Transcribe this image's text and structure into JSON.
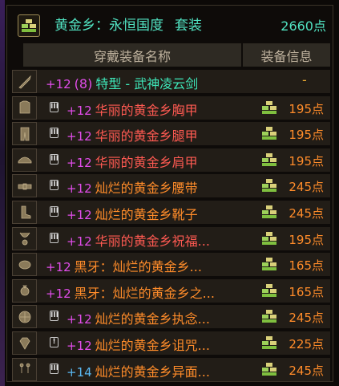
{
  "set": {
    "icon": "set-icon",
    "title": "黄金乡：永恒国度",
    "suffix": "套装",
    "points": "2660点"
  },
  "columns": {
    "name": "穿戴装备名称",
    "info": "装备信息"
  },
  "weapon": {
    "icon": "sword-icon",
    "plus": "+12",
    "refine": "(8)",
    "name": "特型 - 武神凌云剑",
    "info": "-"
  },
  "items": [
    {
      "icon": "armor-chest-icon",
      "plus": "+12",
      "name": "华丽的黄金乡胸甲",
      "points": "195点"
    },
    {
      "icon": "armor-legs-icon",
      "plus": "+12",
      "name": "华丽的黄金乡腿甲",
      "points": "195点"
    },
    {
      "icon": "armor-shoulder-icon",
      "plus": "+12",
      "name": "华丽的黄金乡肩甲",
      "points": "195点"
    },
    {
      "icon": "armor-belt-icon",
      "plus": "+12",
      "name": "灿烂的黄金乡腰带",
      "points": "245点"
    },
    {
      "icon": "armor-boots-icon",
      "plus": "+12",
      "name": "灿烂的黄金乡靴子",
      "points": "245点"
    },
    {
      "icon": "necklace-icon",
      "plus": "+12",
      "name": "华丽的黄金乡祝福...",
      "points": "195点"
    },
    {
      "icon": "bracelet-icon",
      "plus": "+12",
      "prefix": "黑牙：",
      "name": "灿烂的黄金乡...",
      "points": "165点"
    },
    {
      "icon": "ring-icon",
      "plus": "+12",
      "prefix": "黑牙：",
      "name": "灿烂的黄金乡之...",
      "points": "165点"
    },
    {
      "icon": "support-icon",
      "tag": "III",
      "plus": "+12",
      "name": "灿烂的黄金乡执念...",
      "points": "245点"
    },
    {
      "icon": "gem-icon",
      "tag": "!",
      "plus": "+12",
      "name": "灿烂的黄金乡诅咒...",
      "points": "225点"
    },
    {
      "icon": "earring-icon",
      "tag": "III",
      "plus": "+14",
      "name": "灿烂的黄金乡异面...",
      "points": "245点"
    }
  ],
  "tags": {
    "default": "III"
  },
  "colors": {
    "set_text": "#51e3c2",
    "points": "#ff8c2a",
    "plus_purple": "#e14dea",
    "plus_blue": "#5ab8f2",
    "name_pink": "#ff5a52",
    "name_orange": "#ff8c2a"
  }
}
